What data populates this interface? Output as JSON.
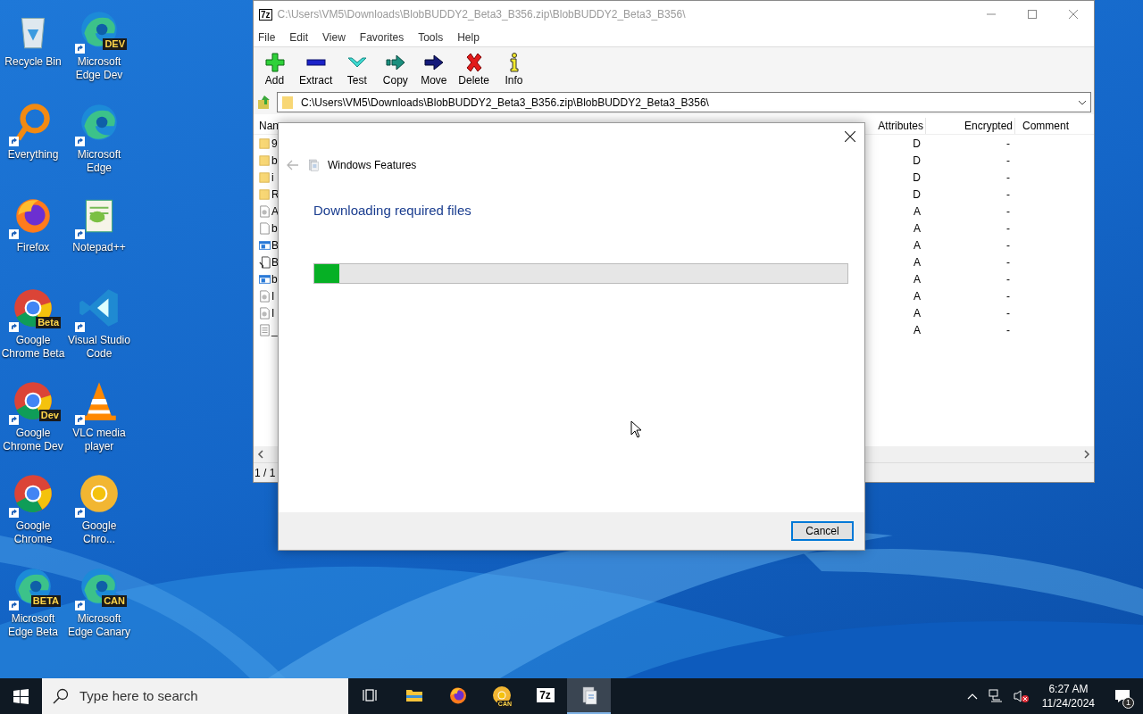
{
  "desktop_icons": [
    {
      "label": "Recycle Bin",
      "kind": "recycle"
    },
    {
      "label": "Everything",
      "kind": "everything"
    },
    {
      "label": "Firefox",
      "kind": "firefox"
    },
    {
      "label": "Google Chrome Beta",
      "kind": "chrome",
      "badge": "Beta"
    },
    {
      "label": "Google Chrome Dev",
      "kind": "chrome",
      "badge": "Dev"
    },
    {
      "label": "Google Chrome",
      "kind": "chrome"
    },
    {
      "label": "Microsoft Edge Beta",
      "kind": "edge",
      "badge": "BETA"
    },
    {
      "label": "Microsoft Edge Dev",
      "kind": "edge",
      "badge": "DEV"
    },
    {
      "label": "Microsoft Edge",
      "kind": "edge"
    },
    {
      "label": "Notepad++",
      "kind": "notepad"
    },
    {
      "label": "Visual Studio Code",
      "kind": "vscode"
    },
    {
      "label": "VLC media player",
      "kind": "vlc"
    },
    {
      "label": "Google Chro...",
      "kind": "canary"
    },
    {
      "label": "Microsoft Edge Canary",
      "kind": "edge",
      "badge": "CAN"
    }
  ],
  "archive_window": {
    "app_badge": "7z",
    "title": "C:\\Users\\VM5\\Downloads\\BlobBUDDY2_Beta3_B356.zip\\BlobBUDDY2_Beta3_B356\\",
    "menu": [
      "File",
      "Edit",
      "View",
      "Favorites",
      "Tools",
      "Help"
    ],
    "toolbar": [
      {
        "label": "Add",
        "kind": "add"
      },
      {
        "label": "Extract",
        "kind": "extract"
      },
      {
        "label": "Test",
        "kind": "test"
      },
      {
        "label": "Copy",
        "kind": "copy"
      },
      {
        "label": "Move",
        "kind": "move"
      },
      {
        "label": "Delete",
        "kind": "delete"
      },
      {
        "label": "Info",
        "kind": "info"
      }
    ],
    "path": "C:\\Users\\VM5\\Downloads\\BlobBUDDY2_Beta3_B356.zip\\BlobBUDDY2_Beta3_B356\\",
    "columns": [
      "Nan",
      "Attributes",
      "Encrypted",
      "Comment"
    ],
    "rows": [
      {
        "name": "9",
        "kind": "folder",
        "attributes": "D",
        "encrypted": "-"
      },
      {
        "name": "b",
        "kind": "folder",
        "attributes": "D",
        "encrypted": "-"
      },
      {
        "name": "i",
        "kind": "folder",
        "attributes": "D",
        "encrypted": "-"
      },
      {
        "name": "R",
        "kind": "folder",
        "attributes": "D",
        "encrypted": "-"
      },
      {
        "name": "A",
        "kind": "settings",
        "attributes": "A",
        "encrypted": "-"
      },
      {
        "name": "b",
        "kind": "blank",
        "attributes": "A",
        "encrypted": "-"
      },
      {
        "name": "B",
        "kind": "app",
        "attributes": "A",
        "encrypted": "-"
      },
      {
        "name": "B",
        "kind": "installer",
        "attributes": "A",
        "encrypted": "-"
      },
      {
        "name": "b",
        "kind": "app",
        "attributes": "A",
        "encrypted": "-"
      },
      {
        "name": "I",
        "kind": "settings",
        "attributes": "A",
        "encrypted": "-"
      },
      {
        "name": "I",
        "kind": "settings",
        "attributes": "A",
        "encrypted": "-"
      },
      {
        "name": "_",
        "kind": "text",
        "attributes": "A",
        "encrypted": "-"
      }
    ],
    "status": "1 / 1"
  },
  "dialog": {
    "title": "Windows Features",
    "heading": "Downloading required files",
    "progress": {
      "level": 0.047
    },
    "button": "Cancel"
  },
  "taskbar": {
    "search_placeholder": "Type here to search",
    "apps": [
      {
        "kind": "taskview",
        "selected": false
      },
      {
        "kind": "explorer",
        "selected": false
      },
      {
        "kind": "firefox",
        "selected": false
      },
      {
        "kind": "canary",
        "badge": "CAN",
        "selected": false
      },
      {
        "kind": "sevenzip",
        "badge": "7z",
        "selected": false
      },
      {
        "kind": "features",
        "selected": true
      }
    ],
    "time": "6:27 AM",
    "date": "11/24/2024",
    "notifications": "1"
  }
}
